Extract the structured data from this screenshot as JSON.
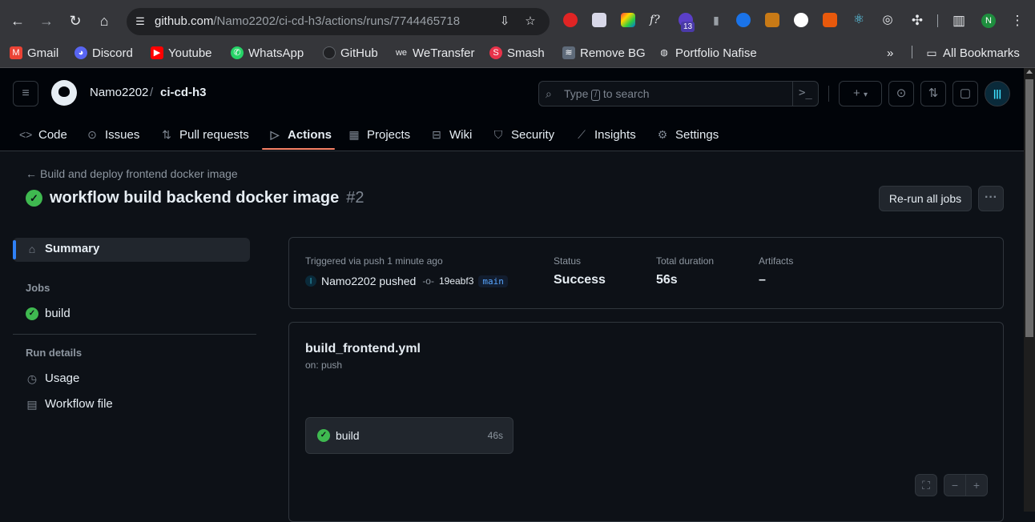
{
  "browser": {
    "url_host": "github.com",
    "url_path": "/Namo2202/ci-cd-h3/actions/runs/7744465718",
    "extension_badge": "13",
    "profile_initial": "N",
    "bookmarks": [
      "Gmail",
      "Discord",
      "Youtube",
      "WhatsApp",
      "GitHub",
      "WeTransfer",
      "Smash",
      "Remove BG",
      "Portfolio Nafise"
    ],
    "all_bookmarks": "All Bookmarks"
  },
  "header": {
    "owner": "Namo2202",
    "slash": "/",
    "repo": "ci-cd-h3",
    "search_prefix": "Type",
    "search_key": "/",
    "search_suffix": "to search",
    "plus": "+",
    "caret": "▾"
  },
  "tabs": [
    {
      "label": "Code",
      "icon": "code-icon"
    },
    {
      "label": "Issues",
      "icon": "issue-icon"
    },
    {
      "label": "Pull requests",
      "icon": "pull-request-icon"
    },
    {
      "label": "Actions",
      "icon": "play-icon",
      "active": true
    },
    {
      "label": "Projects",
      "icon": "table-icon"
    },
    {
      "label": "Wiki",
      "icon": "book-icon"
    },
    {
      "label": "Security",
      "icon": "shield-icon"
    },
    {
      "label": "Insights",
      "icon": "graph-icon"
    },
    {
      "label": "Settings",
      "icon": "gear-icon"
    }
  ],
  "run": {
    "back_label": "Build and deploy frontend docker image",
    "title": "workflow build backend docker image",
    "number": "#2",
    "rerun_label": "Re-run all jobs"
  },
  "sidebar": {
    "summary": "Summary",
    "jobs_heading": "Jobs",
    "job": "build",
    "details_heading": "Run details",
    "usage": "Usage",
    "workflow_file": "Workflow file"
  },
  "summary_card": {
    "trigger": "Triggered via push 1 minute ago",
    "pusher": "Namo2202 pushed",
    "commit": "19eabf3",
    "branch": "main",
    "status_label": "Status",
    "status_value": "Success",
    "duration_label": "Total duration",
    "duration_value": "56s",
    "artifacts_label": "Artifacts",
    "artifacts_value": "–"
  },
  "workflow": {
    "file": "build_frontend.yml",
    "on": "on: push",
    "job_name": "build",
    "job_duration": "46s"
  },
  "colors": {
    "accent": "#2f81f7",
    "success": "#3fb950",
    "tab_underline": "#f78166"
  }
}
